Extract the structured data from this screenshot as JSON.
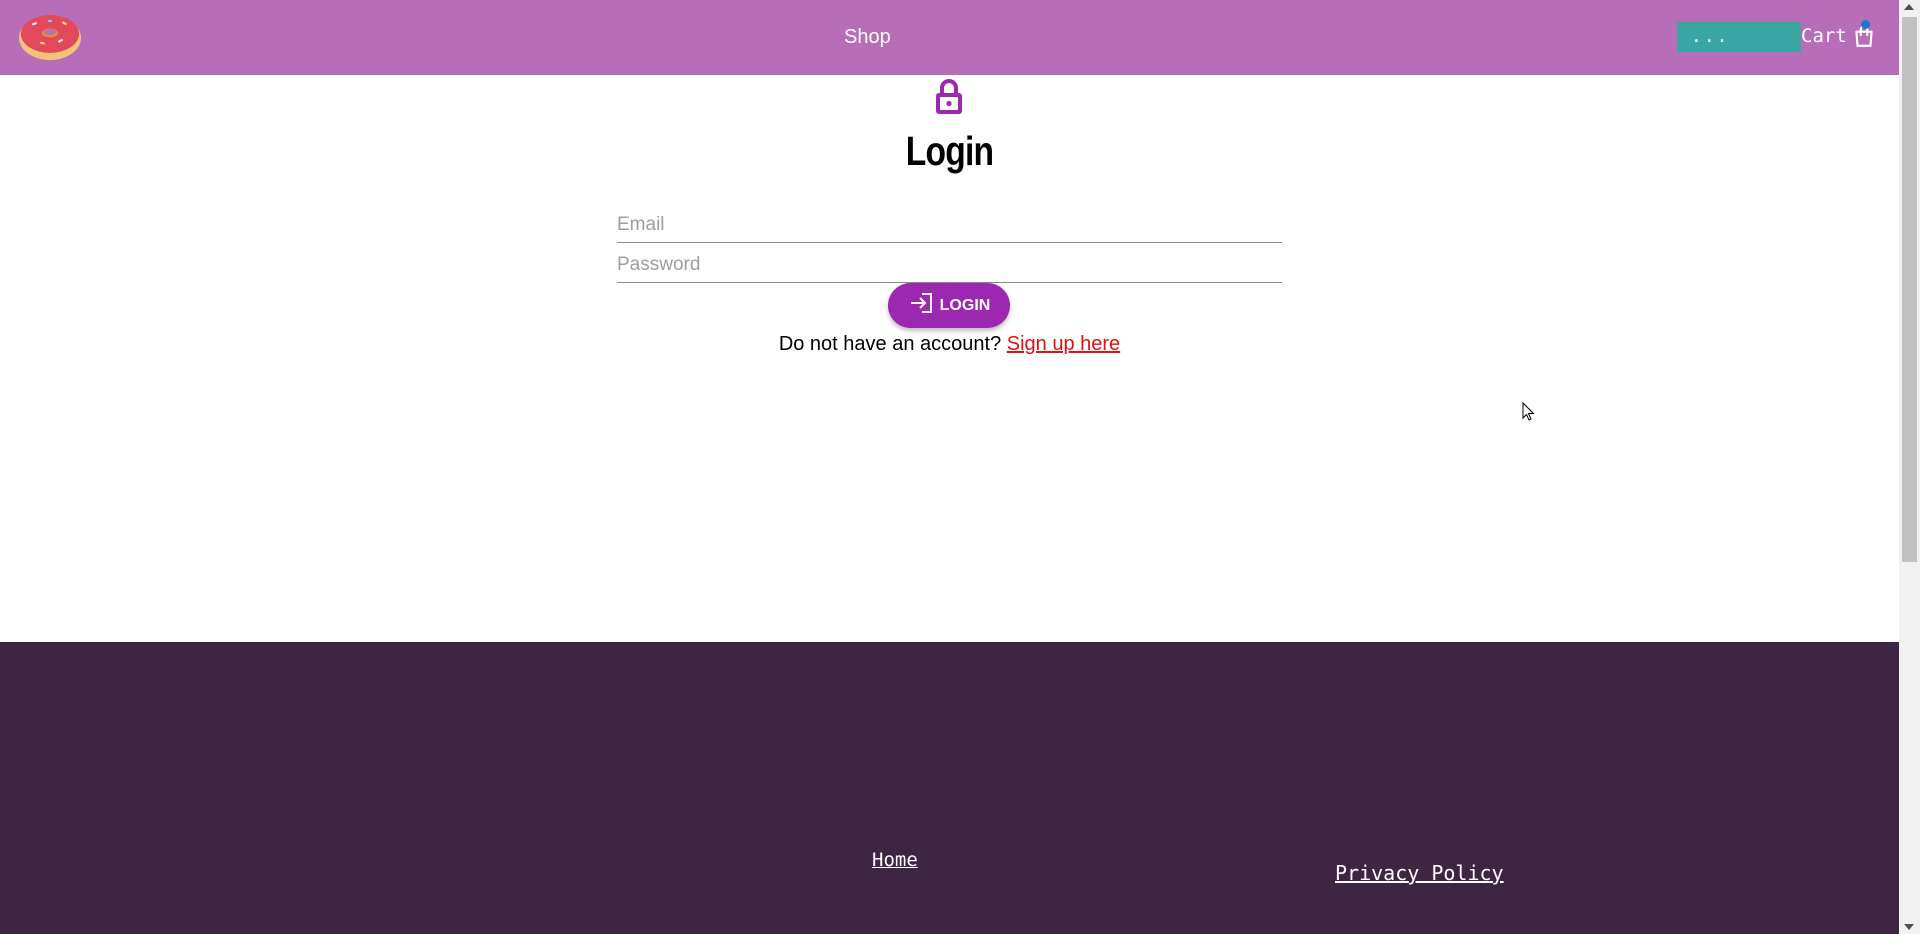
{
  "header": {
    "nav_shop": "Shop",
    "user_chip": "...",
    "cart_label": "Cart",
    "colors": {
      "bar": "#b76db8",
      "user_chip": "#3aa6a3",
      "cart_dot": "#1976d2"
    },
    "logo_icon": "donut-icon",
    "cart_icon": "shopping-bag-icon"
  },
  "main": {
    "lock_icon": "lock-icon",
    "title": "Login",
    "email_placeholder": "Email",
    "password_placeholder": "Password",
    "login_button": "LOGIN",
    "login_icon": "login-arrow-icon",
    "signup_prompt": "Do not have an account?",
    "signup_link": "Sign up here",
    "colors": {
      "accent": "#9c27b0",
      "link": "#e01010"
    }
  },
  "footer": {
    "home_link": "Home",
    "privacy_link": "Privacy Policy",
    "color": "#3e2544"
  }
}
